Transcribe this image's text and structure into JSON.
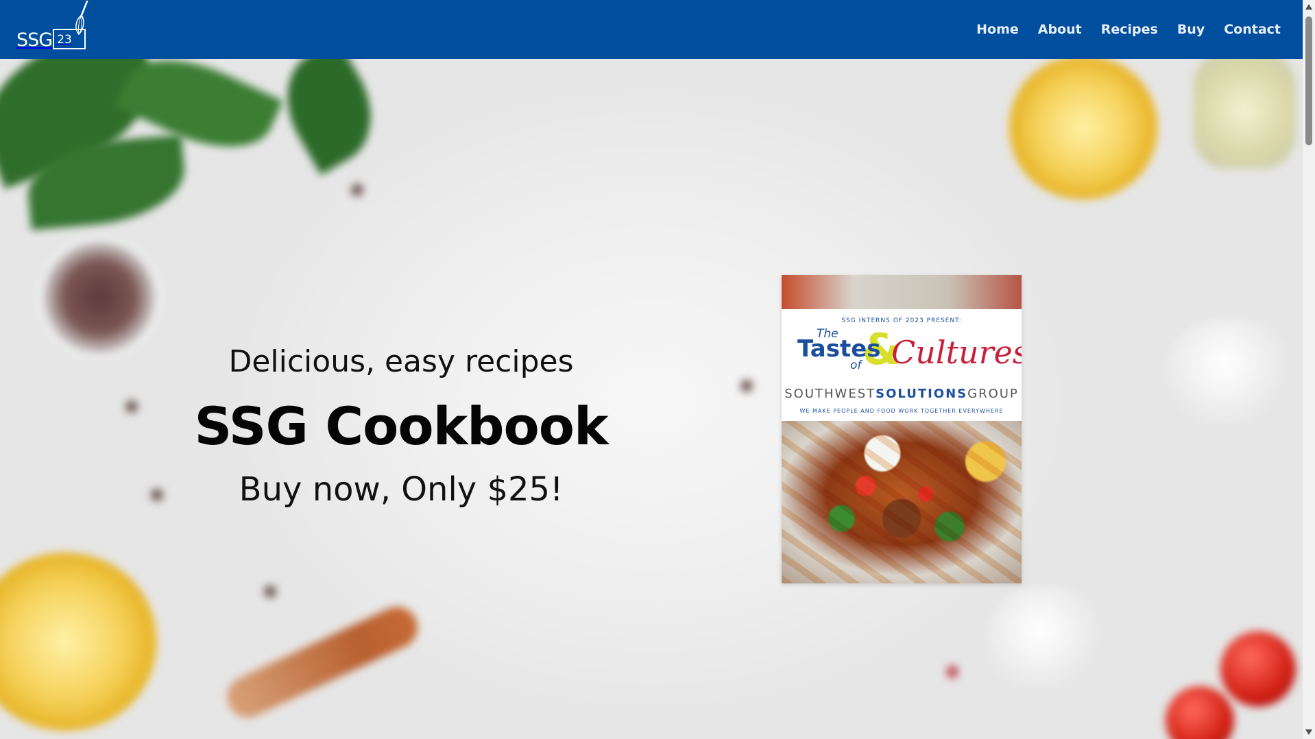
{
  "nav": {
    "logo_text": "SSG",
    "logo_badge": "23",
    "items": [
      "Home",
      "About",
      "Recipes",
      "Buy",
      "Contact"
    ]
  },
  "hero": {
    "tagline": "Delicious, easy recipes",
    "title": "SSG Cookbook",
    "price_text": "Buy now, Only $25!"
  },
  "cover": {
    "presenter": "SSG INTERNS OF 2023 PRESENT:",
    "the": "The",
    "tastes": "Tastes",
    "of": "of",
    "amp": "&",
    "cultures": "Cultures",
    "company_left": "SOUTHWEST",
    "company_bold": "SOLUTIONS",
    "company_right": "GROUP",
    "motto": "WE MAKE PEOPLE AND FOOD WORK TOGETHER EVERYWHERE"
  },
  "colors": {
    "nav_bg": "#004f9e",
    "nav_text": "#e9eef6",
    "cover_blue": "#1a4f9e",
    "cover_red": "#c8203b",
    "cover_yellow": "#d8df2a"
  },
  "icons": [
    "whisk-icon",
    "scroll-up-arrow-icon",
    "scroll-down-arrow-icon"
  ]
}
